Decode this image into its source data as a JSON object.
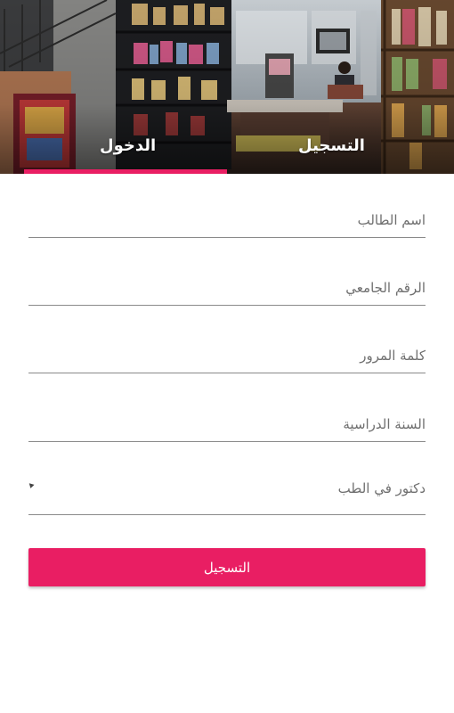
{
  "tabs": {
    "login_label": "الدخول",
    "register_label": "التسجيل",
    "active": "login"
  },
  "form": {
    "student_name_placeholder": "اسم الطالب",
    "student_id_placeholder": "الرقم الجامعي",
    "password_placeholder": "كلمة المرور",
    "academic_year_placeholder": "السنة الدراسية",
    "specialty_selected": "دكتور في الطب",
    "submit_label": "التسجيل"
  },
  "colors": {
    "accent": "#e91e63",
    "divider": "#8a8a8a",
    "placeholder_text": "#6f6f6f"
  }
}
